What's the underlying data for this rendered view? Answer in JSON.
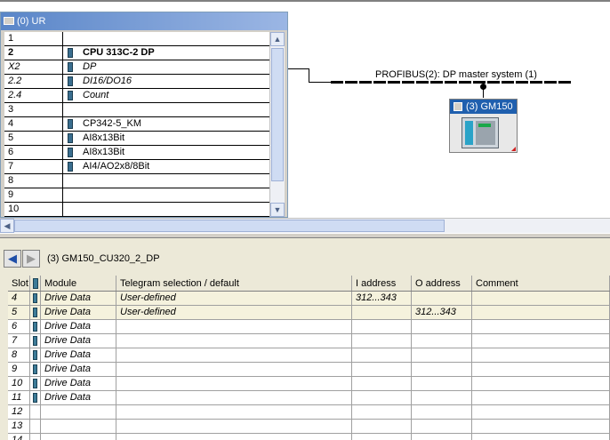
{
  "rack": {
    "title": "(0) UR",
    "rows": [
      {
        "slot": "1",
        "module": "",
        "style": "normal",
        "icon": false
      },
      {
        "slot": "2",
        "module": "CPU 313C-2 DP",
        "style": "bold",
        "icon": true
      },
      {
        "slot": "X2",
        "module": "DP",
        "style": "italic",
        "icon": true
      },
      {
        "slot": "2.2",
        "module": "DI16/DO16",
        "style": "italic",
        "icon": true
      },
      {
        "slot": "2.4",
        "module": "Count",
        "style": "italic",
        "icon": true
      },
      {
        "slot": "3",
        "module": "",
        "style": "normal",
        "icon": false
      },
      {
        "slot": "4",
        "module": "CP342-5_KM",
        "style": "normal",
        "icon": true
      },
      {
        "slot": "5",
        "module": "AI8x13Bit",
        "style": "normal",
        "icon": true
      },
      {
        "slot": "6",
        "module": "AI8x13Bit",
        "style": "normal",
        "icon": true
      },
      {
        "slot": "7",
        "module": "AI4/AO2x8/8Bit",
        "style": "normal",
        "icon": true
      },
      {
        "slot": "8",
        "module": "",
        "style": "normal",
        "icon": false
      },
      {
        "slot": "9",
        "module": "",
        "style": "normal",
        "icon": false
      },
      {
        "slot": "10",
        "module": "",
        "style": "normal",
        "icon": false
      }
    ]
  },
  "network": {
    "bus_label": "PROFIBUS(2): DP master system (1)",
    "device_label": "(3) GM150"
  },
  "detail": {
    "title": "(3)   GM150_CU320_2_DP",
    "columns": {
      "slot": "Slot",
      "module": "Module",
      "telegram": "Telegram selection / default",
      "i_address": "I address",
      "o_address": "O address",
      "comment": "Comment"
    },
    "rows": [
      {
        "slot": "4",
        "module": "Drive Data",
        "telegram": "User-defined",
        "i_address": "312...343",
        "o_address": "",
        "comment": "",
        "icon": true
      },
      {
        "slot": "5",
        "module": "Drive Data",
        "telegram": "User-defined",
        "i_address": "",
        "o_address": "312...343",
        "comment": "",
        "icon": true
      },
      {
        "slot": "6",
        "module": "Drive Data",
        "telegram": "",
        "i_address": "",
        "o_address": "",
        "comment": "",
        "icon": true
      },
      {
        "slot": "7",
        "module": "Drive Data",
        "telegram": "",
        "i_address": "",
        "o_address": "",
        "comment": "",
        "icon": true
      },
      {
        "slot": "8",
        "module": "Drive Data",
        "telegram": "",
        "i_address": "",
        "o_address": "",
        "comment": "",
        "icon": true
      },
      {
        "slot": "9",
        "module": "Drive Data",
        "telegram": "",
        "i_address": "",
        "o_address": "",
        "comment": "",
        "icon": true
      },
      {
        "slot": "10",
        "module": "Drive Data",
        "telegram": "",
        "i_address": "",
        "o_address": "",
        "comment": "",
        "icon": true
      },
      {
        "slot": "11",
        "module": "Drive Data",
        "telegram": "",
        "i_address": "",
        "o_address": "",
        "comment": "",
        "icon": true
      },
      {
        "slot": "12",
        "module": "",
        "telegram": "",
        "i_address": "",
        "o_address": "",
        "comment": "",
        "icon": false
      },
      {
        "slot": "13",
        "module": "",
        "telegram": "",
        "i_address": "",
        "o_address": "",
        "comment": "",
        "icon": false
      },
      {
        "slot": "14",
        "module": "",
        "telegram": "",
        "i_address": "",
        "o_address": "",
        "comment": "",
        "icon": false
      }
    ]
  },
  "colors": {
    "title_bar": "#5a86c8",
    "device_header": "#1f5fae",
    "highlight_row": "#f5f2dd",
    "panel_bg": "#ece9d8"
  }
}
